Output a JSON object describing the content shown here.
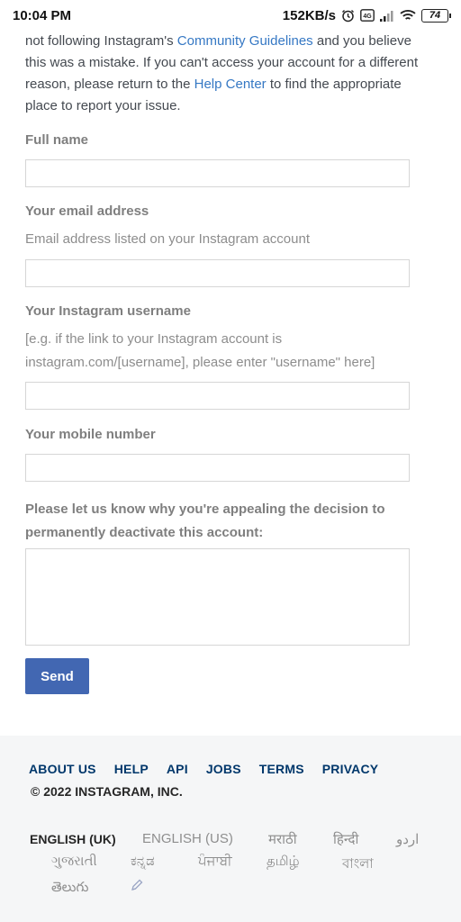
{
  "status_bar": {
    "time": "10:04 PM",
    "speed": "152KB/s",
    "battery": "74"
  },
  "intro": {
    "text_1": "not following Instagram's ",
    "link_1": "Community Guidelines",
    "text_2": " and you believe this was a mistake. If you can't access your account for a different reason, please return to the ",
    "link_2": "Help Center",
    "text_3": " to find the appropriate place to report your issue."
  },
  "form": {
    "full_name_label": "Full name",
    "full_name_value": "",
    "email_label": "Your email address",
    "email_hint": "Email address listed on your Instagram account",
    "email_value": "",
    "username_label": "Your Instagram username",
    "username_hint": "[e.g. if the link to your Instagram account is instagram.com/[username], please enter \"username\" here]",
    "username_value": "",
    "mobile_label": "Your mobile number",
    "mobile_value": "",
    "reason_label": "Please let us know why you're appealing the decision to permanently deactivate this account:",
    "reason_value": "",
    "send_label": "Send"
  },
  "footer": {
    "links": [
      "ABOUT US",
      "HELP",
      "API",
      "JOBS",
      "TERMS",
      "PRIVACY"
    ],
    "copyright": "© 2022 INSTAGRAM, INC.",
    "languages": [
      "ENGLISH (UK)",
      "ENGLISH (US)",
      "मराठी",
      "हिन्दी",
      "اردو",
      "ગુજરાતી",
      "ಕನ್ನಡ",
      "ਪੰਜਾਬੀ",
      "தமிழ்",
      "বাংলা",
      "తెలుగు"
    ],
    "active_language": "ENGLISH (UK)",
    "edit_icon": "pencil-icon"
  },
  "colors": {
    "link": "#3578c4",
    "button": "#4267b2",
    "footer_link": "#00376b",
    "footer_bg": "#f5f6f7"
  }
}
